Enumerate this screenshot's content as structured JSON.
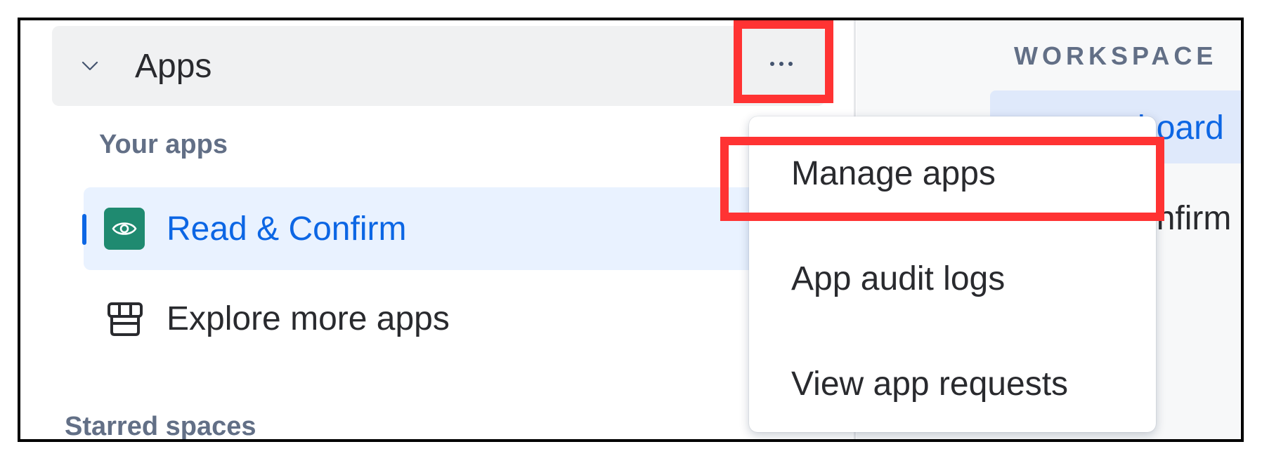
{
  "sidebar": {
    "apps_section": {
      "title": "Apps",
      "more_label": "···"
    },
    "your_apps_label": "Your apps",
    "apps": [
      {
        "label": "Read & Confirm",
        "active": true,
        "icon": "eye-icon"
      }
    ],
    "explore_label": "Explore more apps",
    "starred_label": "Starred spaces"
  },
  "dropdown_menu": {
    "items": [
      {
        "label": "Manage apps",
        "highlighted": true
      },
      {
        "label": "App audit logs"
      },
      {
        "label": "View app requests"
      }
    ]
  },
  "right_pane": {
    "section_label": "WORKSPACE",
    "items": [
      {
        "label_visible": "board"
      },
      {
        "label_visible": "onfirm"
      }
    ]
  },
  "colors": {
    "accent": "#0c66e4",
    "highlight": "#ff3333",
    "app_icon_bg": "#1f8a70",
    "header_bg": "#f0f1f2",
    "active_row_bg": "#e9f2ff"
  }
}
